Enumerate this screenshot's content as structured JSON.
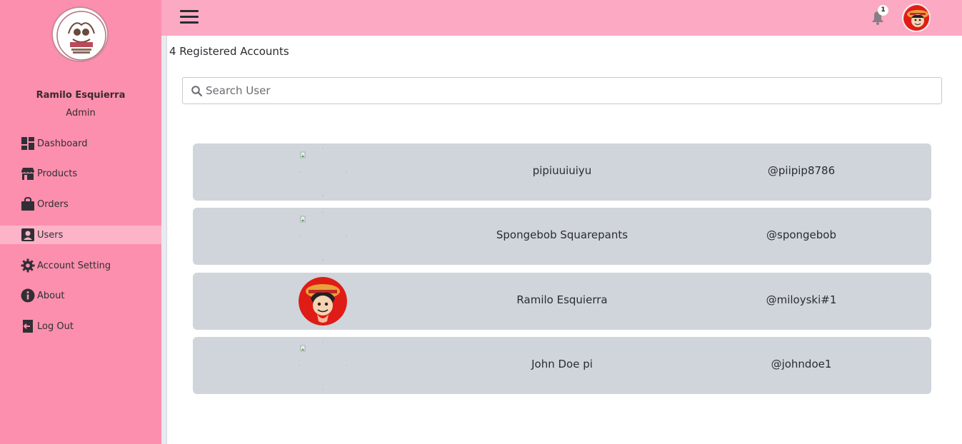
{
  "sidebar": {
    "profile": {
      "name": "Ramilo Esquierra",
      "role": "Admin"
    },
    "items": [
      {
        "label": "Dashboard",
        "icon": "dashboard-icon",
        "active": false
      },
      {
        "label": "Products",
        "icon": "store-icon",
        "active": false
      },
      {
        "label": "Orders",
        "icon": "shopping-bag-icon",
        "active": false
      },
      {
        "label": "Users",
        "icon": "user-card-icon",
        "active": true
      },
      {
        "label": "Account Setting",
        "icon": "gear-icon",
        "active": false
      },
      {
        "label": "About",
        "icon": "info-icon",
        "active": false
      },
      {
        "label": "Log Out",
        "icon": "logout-icon",
        "active": false
      }
    ]
  },
  "topbar": {
    "notification_count": "1"
  },
  "main": {
    "accounts_count": "4 Registered Accounts",
    "search": {
      "placeholder": "Search User",
      "value": ""
    },
    "users": [
      {
        "name": "pipiuuiuiyu",
        "handle": "@piipip8786",
        "avatar": "broken-image"
      },
      {
        "name": "Spongebob Squarepants",
        "handle": "@spongebob",
        "avatar": "broken-image"
      },
      {
        "name": "Ramilo Esquierra",
        "handle": "@miloyski#1",
        "avatar": "luffy-avatar"
      },
      {
        "name": "John Doe pi",
        "handle": "@johndoe1",
        "avatar": "broken-image"
      }
    ]
  },
  "colors": {
    "sidebar_bg": "#fb8fad",
    "topbar_bg": "#fcaac3",
    "active_item_bg": "#fdb3c8",
    "row_bg": "#d0d4db"
  }
}
